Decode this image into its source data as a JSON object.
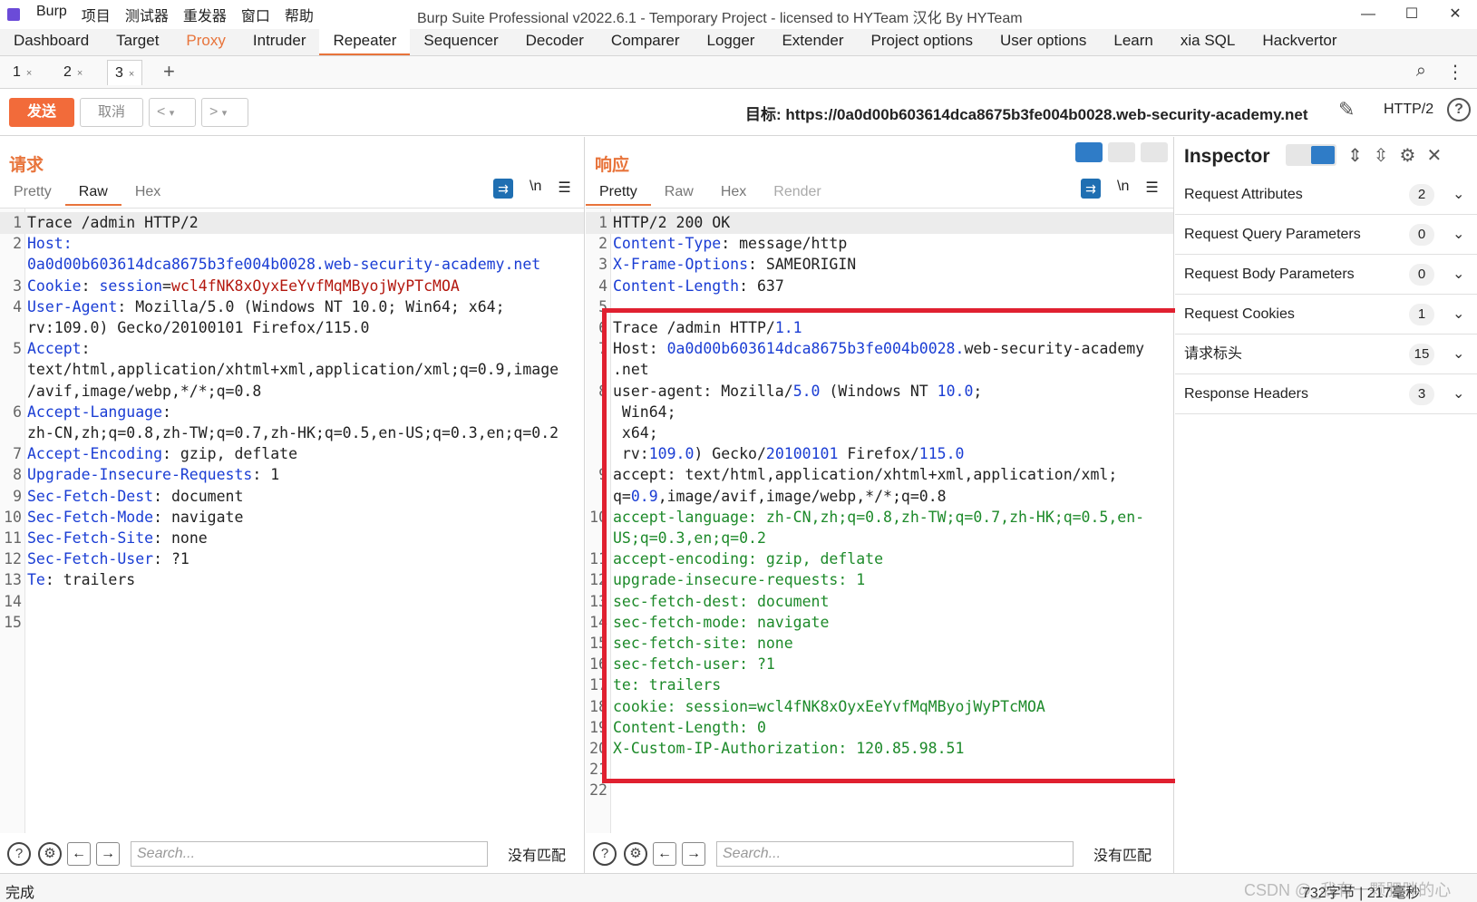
{
  "titlebar": {
    "menu": [
      "Burp",
      "项目",
      "测试器",
      "重发器",
      "窗口",
      "帮助"
    ],
    "title": "Burp Suite Professional v2022.6.1 - Temporary Project - licensed to HYTeam 汉化 By HYTeam"
  },
  "top_tabs": [
    "Dashboard",
    "Target",
    "Proxy",
    "Intruder",
    "Repeater",
    "Sequencer",
    "Decoder",
    "Comparer",
    "Logger",
    "Extender",
    "Project options",
    "User options",
    "Learn",
    "xia SQL",
    "Hackvertor"
  ],
  "sub_tabs": [
    "1",
    "2",
    "3"
  ],
  "toolbar": {
    "send": "发送",
    "cancel": "取消",
    "back": "<",
    "fwd": ">",
    "target_label": "目标:",
    "target_url": "https://0a0d00b603614dca8675b3fe004b0028.web-security-academy.net",
    "protocol": "HTTP/2"
  },
  "request": {
    "title": "请求",
    "views": [
      "Pretty",
      "Raw",
      "Hex"
    ],
    "newline_label": "\\n",
    "lines": [
      {
        "n": "1",
        "segs": [
          [
            "Trace /admin HTTP/2",
            ""
          ]
        ]
      },
      {
        "n": "2",
        "segs": [
          [
            "Host",
            ""
          ],
          [
            ":",
            ""
          ]
        ]
      },
      {
        "n": "",
        "segs": [
          [
            "0a0d00b603614dca8675b3fe004b0028.web-security-academy.net",
            ""
          ]
        ]
      },
      {
        "n": "3",
        "segs": [
          [
            "Cookie",
            ""
          ],
          [
            ": ",
            ""
          ],
          [
            "session",
            ""
          ],
          [
            "=",
            ""
          ],
          [
            "wcl4fNK8xOyxEeYvfMqMByojWyPTcMOA",
            ""
          ]
        ]
      },
      {
        "n": "4",
        "segs": [
          [
            "User-Agent",
            ""
          ],
          [
            ": Mozilla/5.0 (Windows NT 10.0; Win64; x64;",
            ""
          ]
        ]
      },
      {
        "n": "",
        "segs": [
          [
            "rv:109.0) Gecko/20100101 Firefox/115.0",
            ""
          ]
        ]
      },
      {
        "n": "5",
        "segs": [
          [
            "Accept",
            ""
          ],
          [
            ":",
            ""
          ]
        ]
      },
      {
        "n": "",
        "segs": [
          [
            "text/html,application/xhtml+xml,application/xml;q=0.9,image",
            ""
          ]
        ]
      },
      {
        "n": "",
        "segs": [
          [
            "/avif,image/webp,*/*;q=0.8",
            ""
          ]
        ]
      },
      {
        "n": "6",
        "segs": [
          [
            "Accept-Language",
            ""
          ],
          [
            ":",
            ""
          ]
        ]
      },
      {
        "n": "",
        "segs": [
          [
            "zh-CN,zh;q=0.8,zh-TW;q=0.7,zh-HK;q=0.5,en-US;q=0.3,en;q=0.2",
            ""
          ]
        ]
      },
      {
        "n": "7",
        "segs": [
          [
            "Accept-Encoding",
            ""
          ],
          [
            ": gzip, deflate",
            ""
          ]
        ]
      },
      {
        "n": "8",
        "segs": [
          [
            "Upgrade-Insecure-Requests",
            ""
          ],
          [
            ": 1",
            ""
          ]
        ]
      },
      {
        "n": "9",
        "segs": [
          [
            "Sec-Fetch-Dest",
            ""
          ],
          [
            ": document",
            ""
          ]
        ]
      },
      {
        "n": "10",
        "segs": [
          [
            "Sec-Fetch-Mode",
            ""
          ],
          [
            ": navigate",
            ""
          ]
        ]
      },
      {
        "n": "11",
        "segs": [
          [
            "Sec-Fetch-Site",
            ""
          ],
          [
            ": none",
            ""
          ]
        ]
      },
      {
        "n": "12",
        "segs": [
          [
            "Sec-Fetch-User",
            ""
          ],
          [
            ": ?1",
            ""
          ]
        ]
      },
      {
        "n": "13",
        "segs": [
          [
            "Te",
            ""
          ],
          [
            ": trailers",
            ""
          ]
        ]
      },
      {
        "n": "14",
        "segs": []
      },
      {
        "n": "15",
        "segs": []
      }
    ],
    "search_placeholder": "Search...",
    "no_match": "没有匹配"
  },
  "response": {
    "title": "响应",
    "views": [
      "Pretty",
      "Raw",
      "Hex",
      "Render"
    ],
    "newline_label": "\\n",
    "lines": [
      {
        "n": "1",
        "segs": [
          [
            "HTTP/2 200 OK",
            ""
          ]
        ]
      },
      {
        "n": "2",
        "segs": [
          [
            "Content-Type",
            ""
          ],
          [
            ": message/http",
            ""
          ]
        ]
      },
      {
        "n": "3",
        "segs": [
          [
            "X-Frame-Options",
            ""
          ],
          [
            ": SAMEORIGIN",
            ""
          ]
        ]
      },
      {
        "n": "4",
        "segs": [
          [
            "Content-Length",
            ""
          ],
          [
            ": 637",
            ""
          ]
        ]
      },
      {
        "n": "5",
        "segs": []
      },
      {
        "n": "6",
        "segs": [
          [
            "Trace /admin HTTP/",
            ""
          ],
          [
            "1.1",
            ""
          ]
        ]
      },
      {
        "n": "7",
        "segs": [
          [
            "Host: ",
            ""
          ],
          [
            "0a0d00b603614dca8675b3fe004b0028.",
            ""
          ],
          [
            "web-security-academy",
            ""
          ]
        ]
      },
      {
        "n": "",
        "segs": [
          [
            ".net",
            ""
          ]
        ]
      },
      {
        "n": "8",
        "segs": [
          [
            "user-agent: Mozilla/",
            ""
          ],
          [
            "5.0",
            ""
          ],
          [
            " (Windows NT ",
            ""
          ],
          [
            "10.0",
            ""
          ],
          [
            ";",
            ""
          ]
        ]
      },
      {
        "n": "",
        "segs": [
          [
            " Win64;",
            ""
          ]
        ]
      },
      {
        "n": "",
        "segs": [
          [
            " x64;",
            ""
          ]
        ]
      },
      {
        "n": "",
        "segs": [
          [
            " rv:",
            ""
          ],
          [
            "109.0",
            ""
          ],
          [
            ") Gecko/",
            ""
          ],
          [
            "20100101",
            ""
          ],
          [
            " Firefox/",
            ""
          ],
          [
            "115.0",
            ""
          ]
        ]
      },
      {
        "n": "9",
        "segs": [
          [
            "accept: text/html,application/xhtml+xml,application/xml;",
            ""
          ]
        ]
      },
      {
        "n": "",
        "segs": [
          [
            "q=",
            ""
          ],
          [
            "0.9",
            ""
          ],
          [
            ",image/avif,image/webp,*/*;q=0.8",
            ""
          ]
        ]
      },
      {
        "n": "10",
        "segs": [
          [
            "accept-language: zh-CN,zh;q=0.8,zh-TW;q=0.7,zh-HK;q=0.5,en-",
            ""
          ]
        ]
      },
      {
        "n": "",
        "segs": [
          [
            "US;q=0.3,en;q=0.2",
            ""
          ]
        ]
      },
      {
        "n": "11",
        "segs": [
          [
            "accept-encoding: gzip, deflate",
            ""
          ]
        ]
      },
      {
        "n": "12",
        "segs": [
          [
            "upgrade-insecure-requests: 1",
            ""
          ]
        ]
      },
      {
        "n": "13",
        "segs": [
          [
            "sec-fetch-dest: document",
            ""
          ]
        ]
      },
      {
        "n": "14",
        "segs": [
          [
            "sec-fetch-mode: navigate",
            ""
          ]
        ]
      },
      {
        "n": "15",
        "segs": [
          [
            "sec-fetch-site: none",
            ""
          ]
        ]
      },
      {
        "n": "16",
        "segs": [
          [
            "sec-fetch-user: ?1",
            ""
          ]
        ]
      },
      {
        "n": "17",
        "segs": [
          [
            "te: trailers",
            ""
          ]
        ]
      },
      {
        "n": "18",
        "segs": [
          [
            "cookie: session=wcl4fNK8xOyxEeYvfMqMByojWyPTcMOA",
            ""
          ]
        ]
      },
      {
        "n": "19",
        "segs": [
          [
            "Content-Length: 0",
            ""
          ]
        ]
      },
      {
        "n": "20",
        "segs": [
          [
            "X-Custom-IP-Authorization: 120.85.98.51",
            ""
          ]
        ]
      },
      {
        "n": "21",
        "segs": []
      },
      {
        "n": "22",
        "segs": []
      }
    ],
    "search_placeholder": "Search...",
    "no_match": "没有匹配"
  },
  "inspector": {
    "title": "Inspector",
    "rows": [
      {
        "label": "Request Attributes",
        "count": "2"
      },
      {
        "label": "Request Query Parameters",
        "count": "0"
      },
      {
        "label": "Request Body Parameters",
        "count": "0"
      },
      {
        "label": "Request Cookies",
        "count": "1"
      },
      {
        "label": "请求标头",
        "count": "15"
      },
      {
        "label": "Response Headers",
        "count": "3"
      }
    ]
  },
  "status": {
    "left": "完成",
    "right": "732字节 | 217毫秒",
    "watermark": "CSDN @_我有一颗肥胖的心"
  },
  "colors": {
    "accent": "#e8743b",
    "send": "#f26b3a",
    "highlight_box": "#e02030",
    "key": "#1a3dd4",
    "value_red": "#b3170e",
    "green": "#1d8a2a"
  }
}
